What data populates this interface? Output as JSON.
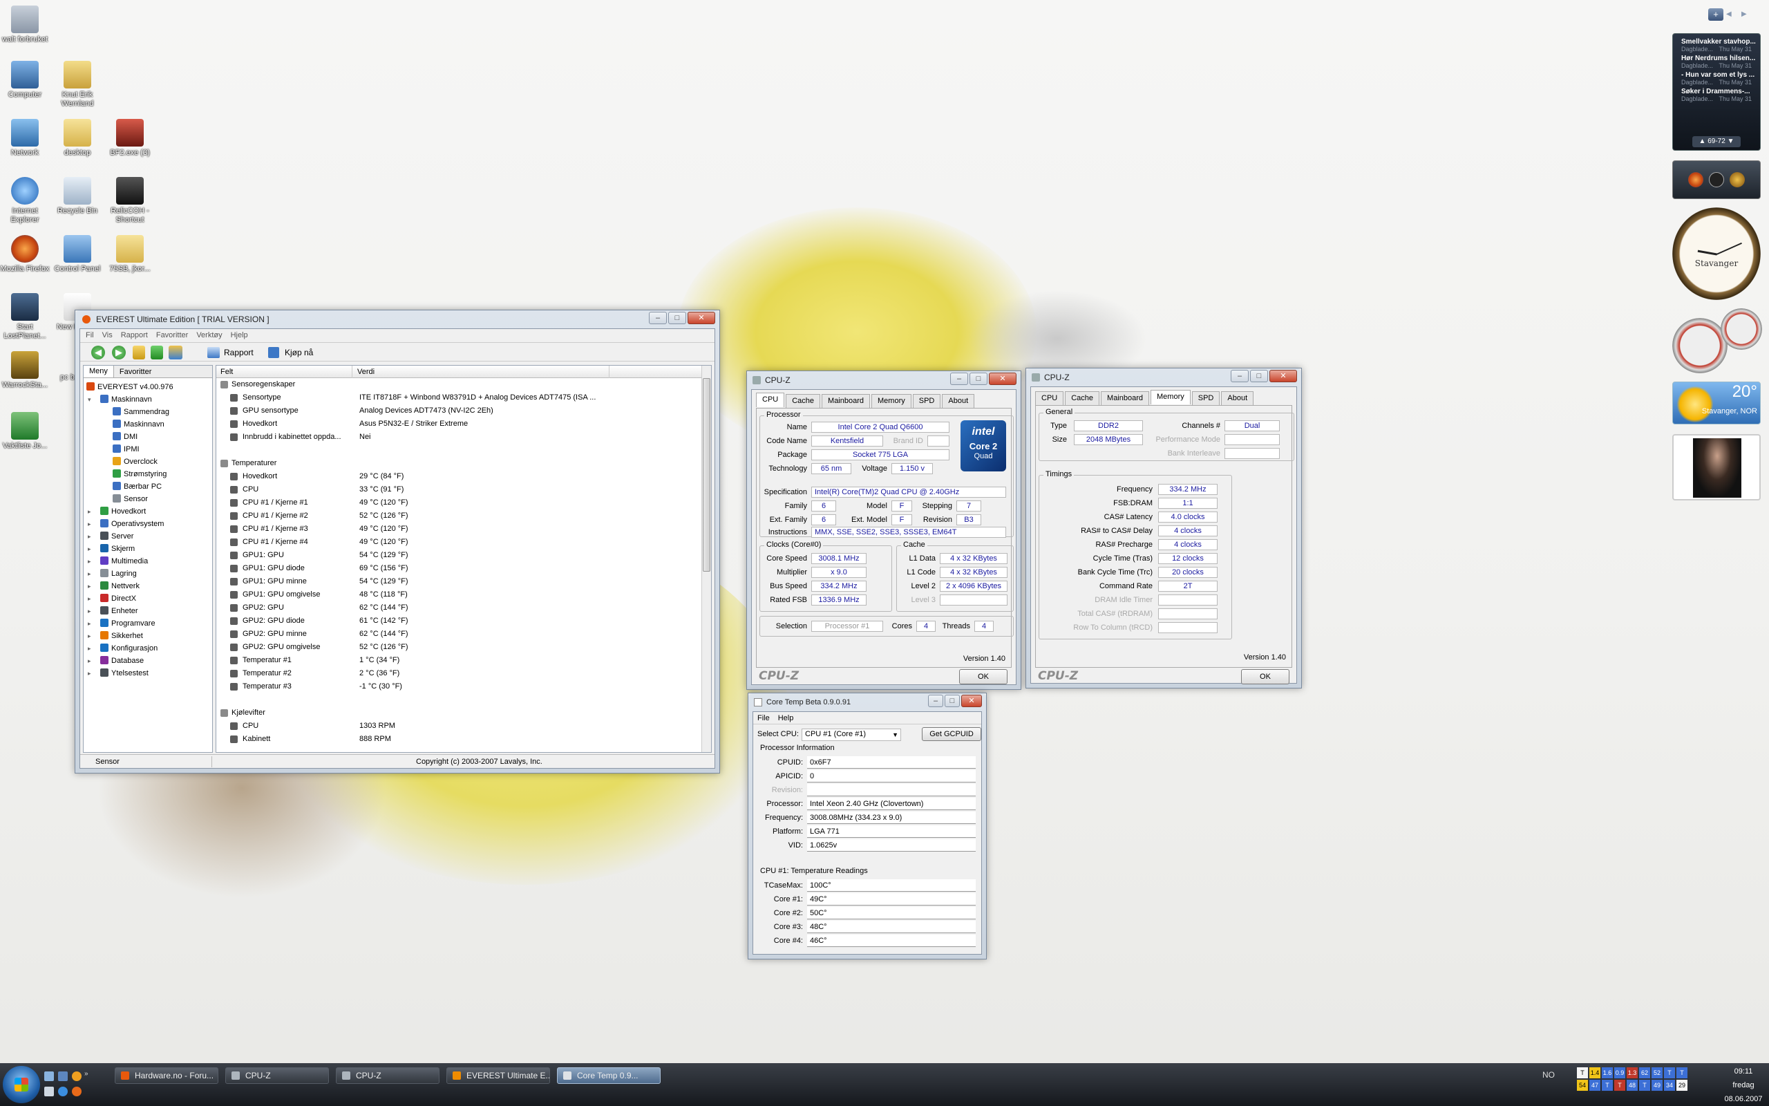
{
  "desktop_icons": [
    {
      "label": "walt forbruket"
    },
    {
      "label": "Computer"
    },
    {
      "label": "Knut Erik Wernland"
    },
    {
      "label": "Network"
    },
    {
      "label": "desktop"
    },
    {
      "label": "BF2.exe (3)"
    },
    {
      "label": "Internet Explorer"
    },
    {
      "label": "Recycle Bin"
    },
    {
      "label": "RelicCOH - Shortcut"
    },
    {
      "label": "Mozilla Firefox"
    },
    {
      "label": "Control Panel"
    },
    {
      "label": "75SB, jkor..."
    },
    {
      "label": "Start LostPlanet..."
    },
    {
      "label": "New Docu..."
    },
    {
      "label": "WarrockSta..."
    },
    {
      "label": "pc b..."
    },
    {
      "label": "Vaktliste Jo..."
    }
  ],
  "everest": {
    "title": "EVEREST Ultimate Edition  [ TRIAL VERSION ]",
    "menu": [
      "Fil",
      "Vis",
      "Rapport",
      "Favoritter",
      "Verktøy",
      "Hjelp"
    ],
    "toolbar": {
      "report": "Rapport",
      "buy": "Kjøp nå"
    },
    "panel_tabs": [
      "Meny",
      "Favoritter"
    ],
    "tree": [
      {
        "label": "EVERYEST v4.00.976",
        "level": 0,
        "color": "#d9480f"
      },
      {
        "label": "Maskinnavn",
        "level": 1,
        "color": "#3b6fc2"
      },
      {
        "label": "Sammendrag",
        "level": 2,
        "color": "#3b6fc2"
      },
      {
        "label": "Maskinnavn",
        "level": 2,
        "color": "#3b6fc2"
      },
      {
        "label": "DMI",
        "level": 2,
        "color": "#3b6fc2"
      },
      {
        "label": "IPMI",
        "level": 2,
        "color": "#3b6fc2"
      },
      {
        "label": "Overclock",
        "level": 2,
        "color": "#e8a317"
      },
      {
        "label": "Strømstyring",
        "level": 2,
        "color": "#2f9e44"
      },
      {
        "label": "Bærbar PC",
        "level": 2,
        "color": "#3b6fc2"
      },
      {
        "label": "Sensor",
        "level": 2,
        "color": "#868e96"
      },
      {
        "label": "Hovedkort",
        "level": 1,
        "color": "#2f9e44"
      },
      {
        "label": "Operativsystem",
        "level": 1,
        "color": "#3b6fc2"
      },
      {
        "label": "Server",
        "level": 1,
        "color": "#495057"
      },
      {
        "label": "Skjerm",
        "level": 1,
        "color": "#1864ab"
      },
      {
        "label": "Multimedia",
        "level": 1,
        "color": "#5f3dc4"
      },
      {
        "label": "Lagring",
        "level": 1,
        "color": "#868e96"
      },
      {
        "label": "Nettverk",
        "level": 1,
        "color": "#2b8a3e"
      },
      {
        "label": "DirectX",
        "level": 1,
        "color": "#c92a2a"
      },
      {
        "label": "Enheter",
        "level": 1,
        "color": "#495057"
      },
      {
        "label": "Programvare",
        "level": 1,
        "color": "#1971c2"
      },
      {
        "label": "Sikkerhet",
        "level": 1,
        "color": "#e67700"
      },
      {
        "label": "Konfigurasjon",
        "level": 1,
        "color": "#1971c2"
      },
      {
        "label": "Database",
        "level": 1,
        "color": "#862e9c"
      },
      {
        "label": "Ytelsestest",
        "level": 1,
        "color": "#495057"
      }
    ],
    "columns": [
      "Felt",
      "Verdi"
    ],
    "rows": [
      {
        "type": "section",
        "field": "Sensoregenskaper"
      },
      {
        "field": "Sensortype",
        "value": "ITE IT8718F + Winbond W83791D + Analog Devices ADT7475  (ISA ..."
      },
      {
        "field": "GPU sensortype",
        "value": "Analog Devices ADT7473  (NV-I2C 2Eh)"
      },
      {
        "field": "Hovedkort",
        "value": "Asus P5N32-E / Striker Extreme"
      },
      {
        "field": "Innbrudd i kabinettet oppda...",
        "value": "Nei"
      },
      {
        "type": "blank"
      },
      {
        "type": "section",
        "field": "Temperaturer"
      },
      {
        "field": "Hovedkort",
        "value": "29 °C  (84 °F)"
      },
      {
        "field": "CPU",
        "value": "33 °C  (91 °F)"
      },
      {
        "field": "CPU #1 / Kjerne #1",
        "value": "49 °C  (120 °F)"
      },
      {
        "field": "CPU #1 / Kjerne #2",
        "value": "52 °C  (126 °F)"
      },
      {
        "field": "CPU #1 / Kjerne #3",
        "value": "49 °C  (120 °F)"
      },
      {
        "field": "CPU #1 / Kjerne #4",
        "value": "49 °C  (120 °F)"
      },
      {
        "field": "GPU1: GPU",
        "value": "54 °C  (129 °F)"
      },
      {
        "field": "GPU1: GPU diode",
        "value": "69 °C  (156 °F)"
      },
      {
        "field": "GPU1: GPU minne",
        "value": "54 °C  (129 °F)"
      },
      {
        "field": "GPU1: GPU omgivelse",
        "value": "48 °C  (118 °F)"
      },
      {
        "field": "GPU2: GPU",
        "value": "62 °C  (144 °F)"
      },
      {
        "field": "GPU2: GPU diode",
        "value": "61 °C  (142 °F)"
      },
      {
        "field": "GPU2: GPU minne",
        "value": "62 °C  (144 °F)"
      },
      {
        "field": "GPU2: GPU omgivelse",
        "value": "52 °C  (126 °F)"
      },
      {
        "field": "Temperatur #1",
        "value": "1 °C  (34 °F)"
      },
      {
        "field": "Temperatur #2",
        "value": "2 °C  (36 °F)"
      },
      {
        "field": "Temperatur #3",
        "value": "-1 °C  (30 °F)"
      },
      {
        "type": "blank"
      },
      {
        "type": "section",
        "field": "Kjølevifter"
      },
      {
        "field": "CPU",
        "value": "1303 RPM"
      },
      {
        "field": "Kabinett",
        "value": "888 RPM"
      }
    ],
    "status_left": "Sensor",
    "status_right": "Copyright (c) 2003-2007 Lavalys, Inc."
  },
  "cpuz_cpu": {
    "title": "CPU-Z",
    "tabs": [
      "CPU",
      "Cache",
      "Mainboard",
      "Memory",
      "SPD",
      "About"
    ],
    "processor_group": "Processor",
    "name_label": "Name",
    "name": "Intel Core 2 Quad Q6600",
    "codename_label": "Code Name",
    "codename": "Kentsfield",
    "brandid_label": "Brand ID",
    "package_label": "Package",
    "package": "Socket 775 LGA",
    "tech_label": "Technology",
    "tech": "65 nm",
    "voltage_label": "Voltage",
    "voltage": "1.150 v",
    "spec_label": "Specification",
    "spec": "Intel(R) Core(TM)2 Quad CPU        @ 2.40GHz",
    "family_label": "Family",
    "family": "6",
    "model_label": "Model",
    "model": "F",
    "stepping_label": "Stepping",
    "stepping": "7",
    "extfamily_label": "Ext. Family",
    "extfamily": "6",
    "extmodel_label": "Ext. Model",
    "extmodel": "F",
    "revision_label": "Revision",
    "revision": "B3",
    "instr_label": "Instructions",
    "instr": "MMX, SSE, SSE2, SSE3, SSSE3, EM64T",
    "clocks_group": "Clocks (Core#0)",
    "corespeed_label": "Core Speed",
    "corespeed": "3008.1 MHz",
    "multiplier_label": "Multiplier",
    "multiplier": "x 9.0",
    "busspeed_label": "Bus Speed",
    "busspeed": "334.2 MHz",
    "fsb_label": "Rated FSB",
    "fsb": "1336.9 MHz",
    "cache_group": "Cache",
    "l1d_label": "L1 Data",
    "l1d": "4 x 32 KBytes",
    "l1c_label": "L1 Code",
    "l1c": "4 x 32 KBytes",
    "l2_label": "Level 2",
    "l2": "2 x 4096 KBytes",
    "l3_label": "Level 3",
    "selection_label": "Selection",
    "selection": "Processor #1",
    "cores_label": "Cores",
    "cores": "4",
    "threads_label": "Threads",
    "threads": "4",
    "version": "Version 1.40",
    "brand": "CPU-Z",
    "ok": "OK",
    "logo_top": "intel",
    "logo_mid": "Core 2",
    "logo_bottom": "Quad"
  },
  "cpuz_mem": {
    "title": "CPU-Z",
    "tabs": [
      "CPU",
      "Cache",
      "Mainboard",
      "Memory",
      "SPD",
      "About"
    ],
    "general_group": "General",
    "type_label": "Type",
    "type": "DDR2",
    "size_label": "Size",
    "size": "2048 MBytes",
    "channels_label": "Channels #",
    "channels": "Dual",
    "perfmode_label": "Performance Mode",
    "bank_label": "Bank Interleave",
    "timings_group": "Timings",
    "timings": [
      {
        "label": "Frequency",
        "value": "334.2 MHz"
      },
      {
        "label": "FSB:DRAM",
        "value": "1:1"
      },
      {
        "label": "CAS# Latency",
        "value": "4.0 clocks"
      },
      {
        "label": "RAS# to CAS# Delay",
        "value": "4 clocks"
      },
      {
        "label": "RAS# Precharge",
        "value": "4 clocks"
      },
      {
        "label": "Cycle Time (Tras)",
        "value": "12 clocks"
      },
      {
        "label": "Bank Cycle Time (Trc)",
        "value": "20 clocks"
      },
      {
        "label": "Command Rate",
        "value": "2T"
      },
      {
        "label": "DRAM Idle Timer",
        "value": ""
      },
      {
        "label": "Total CAS# (tRDRAM)",
        "value": ""
      },
      {
        "label": "Row To Column (tRCD)",
        "value": ""
      }
    ],
    "version": "Version 1.40",
    "brand": "CPU-Z",
    "ok": "OK"
  },
  "coretemp": {
    "title": "Core Temp Beta 0.9.0.91",
    "menu": [
      "File",
      "Help"
    ],
    "select_label": "Select CPU:",
    "select": "CPU #1 (Core #1)",
    "gcpuid": "Get GCPUID",
    "info_header": "Processor Information",
    "info": [
      {
        "label": "CPUID:",
        "value": "0x6F7"
      },
      {
        "label": "APICID:",
        "value": "0"
      },
      {
        "label": "Revision:",
        "value": ""
      },
      {
        "label": "Processor:",
        "value": "Intel Xeon 2.40 GHz (Clovertown)"
      },
      {
        "label": "Frequency:",
        "value": "3008.08MHz (334.23 x 9.0)"
      },
      {
        "label": "Platform:",
        "value": "LGA 771"
      },
      {
        "label": "VID:",
        "value": "1.0625v"
      }
    ],
    "temp_header": "CPU #1: Temperature Readings",
    "temps": [
      {
        "label": "TCaseMax:",
        "value": "100C°"
      },
      {
        "label": "Core #1:",
        "value": "49C°"
      },
      {
        "label": "Core #2:",
        "value": "50C°"
      },
      {
        "label": "Core #3:",
        "value": "48C°"
      },
      {
        "label": "Core #4:",
        "value": "46C°"
      }
    ]
  },
  "sidebar": {
    "feeds": [
      {
        "title": "Smellvakker stavhop...",
        "source": "Dagblade...",
        "date": "Thu May 31"
      },
      {
        "title": "Hør Nerdrums hilsen...",
        "source": "Dagblade...",
        "date": "Thu May 31"
      },
      {
        "title": "- Hun var som et lys ...",
        "source": "Dagblade...",
        "date": "Thu May 31"
      },
      {
        "title": "Søker i Drammens-...",
        "source": "Dagblade...",
        "date": "Thu May 31"
      }
    ],
    "feed_pager": "69-72",
    "clock_city": "Stavanger",
    "weather_temp": "20°",
    "weather_city": "Stavanger, NOR"
  },
  "taskbar": {
    "buttons": [
      {
        "label": "Hardware.no - Foru...",
        "color": "#e8590c",
        "active": false
      },
      {
        "label": "CPU-Z",
        "color": "#adb5bd",
        "active": false
      },
      {
        "label": "CPU-Z",
        "color": "#adb5bd",
        "active": false
      },
      {
        "label": "EVEREST Ultimate E...",
        "color": "#f08c00",
        "active": false
      },
      {
        "label": "Core Temp 0.9...",
        "color": "#dee2e6",
        "active": true
      }
    ],
    "lang": "NO",
    "time": "09:11",
    "day": "fredag",
    "date": "08.06.2007",
    "tray_top": [
      "T",
      "1.4",
      "1.6",
      "0.9",
      "1.3",
      "62",
      "52",
      "T",
      "T"
    ],
    "tray_bottom": [
      "54",
      "47",
      "T",
      "T",
      "48",
      "T",
      "49",
      "34",
      "29"
    ]
  }
}
